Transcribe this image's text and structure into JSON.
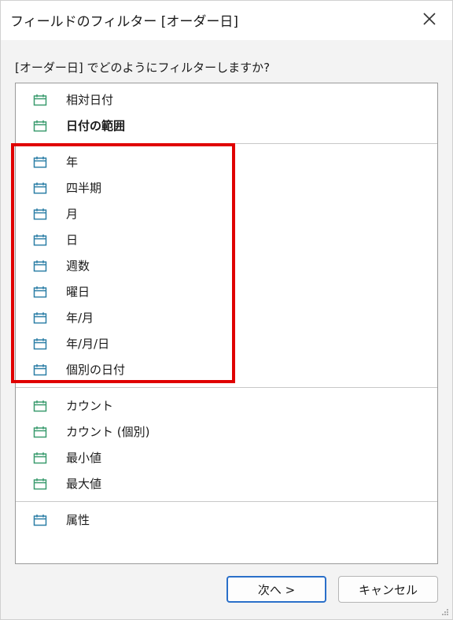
{
  "window": {
    "title": "フィールドのフィルター [オーダー日]"
  },
  "prompt": "[オーダー日] でどのようにフィルターしますか?",
  "groups": [
    {
      "items": [
        {
          "label": "相対日付",
          "bold": false,
          "icon": "calendar-icon",
          "color": "#3a9b6e"
        },
        {
          "label": "日付の範囲",
          "bold": true,
          "icon": "calendar-icon",
          "color": "#3a9b6e"
        }
      ]
    },
    {
      "items": [
        {
          "label": "年",
          "bold": false,
          "icon": "calendar-icon",
          "color": "#2c7fa6"
        },
        {
          "label": "四半期",
          "bold": false,
          "icon": "calendar-icon",
          "color": "#2c7fa6"
        },
        {
          "label": "月",
          "bold": false,
          "icon": "calendar-icon",
          "color": "#2c7fa6"
        },
        {
          "label": "日",
          "bold": false,
          "icon": "calendar-icon",
          "color": "#2c7fa6"
        },
        {
          "label": "週数",
          "bold": false,
          "icon": "calendar-icon",
          "color": "#2c7fa6"
        },
        {
          "label": "曜日",
          "bold": false,
          "icon": "calendar-icon",
          "color": "#2c7fa6"
        },
        {
          "label": "年/月",
          "bold": false,
          "icon": "calendar-icon",
          "color": "#2c7fa6"
        },
        {
          "label": "年/月/日",
          "bold": false,
          "icon": "calendar-icon",
          "color": "#2c7fa6"
        },
        {
          "label": "個別の日付",
          "bold": false,
          "icon": "calendar-icon",
          "color": "#2c7fa6"
        }
      ]
    },
    {
      "items": [
        {
          "label": "カウント",
          "bold": false,
          "icon": "calendar-icon",
          "color": "#3a9b6e"
        },
        {
          "label": "カウント (個別)",
          "bold": false,
          "icon": "calendar-icon",
          "color": "#3a9b6e"
        },
        {
          "label": "最小値",
          "bold": false,
          "icon": "calendar-icon",
          "color": "#3a9b6e"
        },
        {
          "label": "最大値",
          "bold": false,
          "icon": "calendar-icon",
          "color": "#3a9b6e"
        }
      ]
    },
    {
      "items": [
        {
          "label": "属性",
          "bold": false,
          "icon": "calendar-icon",
          "color": "#2c7fa6"
        }
      ]
    }
  ],
  "buttons": {
    "next": "次へ >",
    "cancel": "キャンセル"
  },
  "colors": {
    "highlight": "#e00000",
    "accent": "#2a6fc9"
  }
}
